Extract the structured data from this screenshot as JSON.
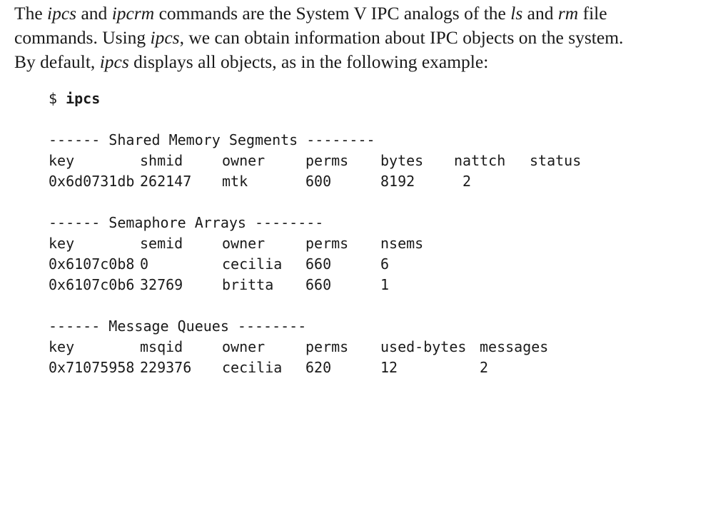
{
  "paragraph": {
    "line1": {
      "t1": "The ",
      "ipcs": "ipcs",
      "t2": " and ",
      "ipcrm": "ipcrm",
      "t3": " commands are the System V IPC analogs of the ",
      "ls": "ls",
      "t4": " and ",
      "rm": "rm",
      "t5": " file"
    },
    "line2": {
      "t1": "commands. Using ",
      "ipcs": "ipcs",
      "t2": ", we can obtain information about IPC objects on the system."
    },
    "line3": {
      "t1": "By default, ",
      "ipcs": "ipcs",
      "t2": " displays all objects, as in the following example:"
    }
  },
  "listing": {
    "prompt": "$ ",
    "command": "ipcs",
    "shared_memory": {
      "heading": "------ Shared Memory Segments --------",
      "headers": [
        "key",
        "shmid",
        "owner",
        "perms",
        "bytes",
        "nattch",
        "status"
      ],
      "rows": [
        [
          "0x6d0731db",
          "262147",
          "mtk",
          "600",
          "8192",
          "2",
          ""
        ]
      ]
    },
    "semaphores": {
      "heading": "------ Semaphore Arrays --------",
      "headers": [
        "key",
        "semid",
        "owner",
        "perms",
        "nsems"
      ],
      "rows": [
        [
          "0x6107c0b8",
          "0",
          "cecilia",
          "660",
          "6"
        ],
        [
          "0x6107c0b6",
          "32769",
          "britta",
          "660",
          "1"
        ]
      ]
    },
    "message_queues": {
      "heading": "------ Message Queues --------",
      "headers": [
        "key",
        "msqid",
        "owner",
        "perms",
        "used-bytes",
        "messages"
      ],
      "rows": [
        [
          "0x71075958",
          "229376",
          "cecilia",
          "620",
          "12",
          "2"
        ]
      ]
    }
  }
}
